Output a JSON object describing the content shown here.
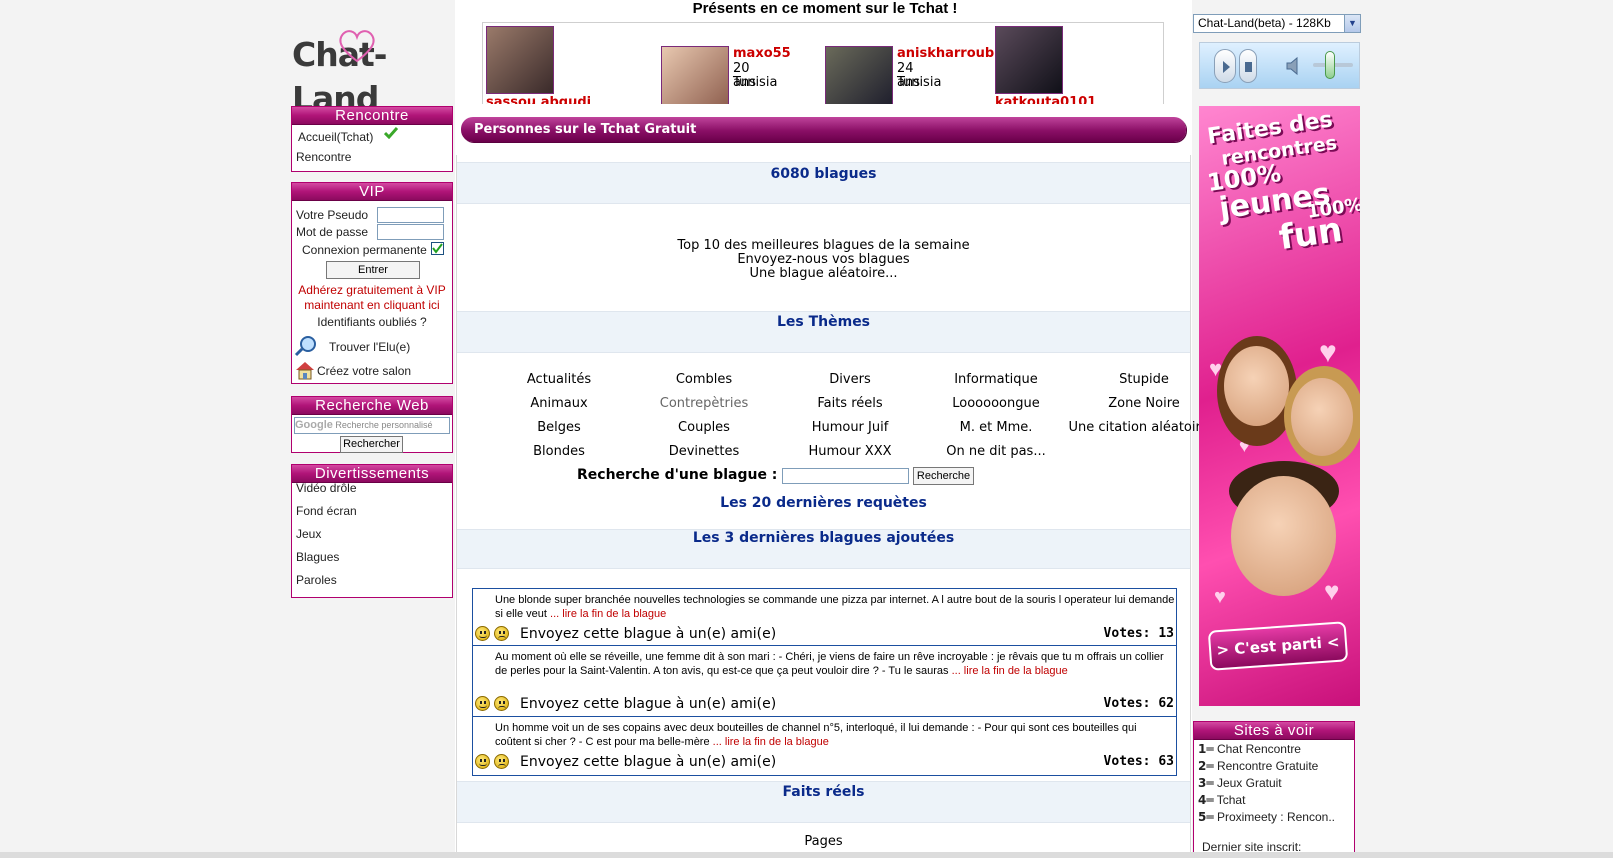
{
  "logo": {
    "text": "Chat-Land"
  },
  "header": {
    "present_title": "Présents en ce moment sur le Tchat !"
  },
  "online_users": [
    {
      "pseudo": "sassou  abqudi"
    },
    {
      "pseudo": "maxo55",
      "age": "20 ans",
      "country": "Tunisia"
    },
    {
      "pseudo": "aniskharroubi",
      "age": "24 ans",
      "country": "Tunisia"
    },
    {
      "pseudo": "katkouta0101"
    }
  ],
  "left": {
    "rencontre": {
      "title": "Rencontre",
      "items": [
        "Accueil(Tchat)",
        "Rencontre"
      ]
    },
    "vip": {
      "title": "VIP",
      "pseudo_label": "Votre Pseudo",
      "password_label": "Mot de passe",
      "permanent_label": "Connexion permanente",
      "enter_button": "Entrer",
      "join_line1": "Adhérez gratuitement à  VIP",
      "join_line2": "maintenant en cliquant ici",
      "forgot": "Identifiants oubliés ?",
      "find_love": "Trouver l'Elu(e)",
      "create_room": "Créez votre salon"
    },
    "web_search": {
      "title": "Recherche Web",
      "placeholder": "Recherche personnalisé",
      "button": "Rechercher",
      "google": "Google"
    },
    "entertainment": {
      "title": "Divertissements",
      "items": [
        "Vidéo drôle",
        "Fond écran",
        "Jeux",
        "Blagues",
        "Paroles"
      ]
    }
  },
  "center": {
    "bar_title": "Personnes sur le Tchat Gratuit",
    "count_title": "6080 blagues",
    "links": [
      "Top 10 des meilleures blagues de la semaine",
      "Envoyez-nous vos blagues",
      "Une blague aléatoire..."
    ],
    "themes_title": "Les Thèmes",
    "themes": [
      [
        "Actualités",
        "Combles",
        "Divers",
        "Informatique",
        "Stupide"
      ],
      [
        "Animaux",
        "Contrepètries",
        "Faits réels",
        "Loooooongue",
        "Zone Noire"
      ],
      [
        "Belges",
        "Couples",
        "Humour Juif",
        "M. et Mme.",
        "Une citation aléatoire?"
      ],
      [
        "Blondes",
        "Devinettes",
        "Humour XXX",
        "On ne dit pas...",
        ""
      ]
    ],
    "search_label": "Recherche d'une blague :",
    "search_button": "Recherche",
    "last_queries": "Les 20 dernières requètes",
    "last_jokes_title": "Les 3 dernières blagues ajoutées",
    "jokes": [
      {
        "text": "Une blonde super branchée nouvelles technologies se commande une pizza par internet. A l autre bout de la souris l operateur lui demande si elle veut",
        "more": "... lire la fin de la blague",
        "send": "Envoyez cette blague à un(e) ami(e)",
        "votes": "Votes: 13"
      },
      {
        "text": "Au moment où elle se réveille, une femme dit à son mari : - Chéri, je viens de faire un rêve incroyable : je rêvais que tu m offrais un collier de perles pour la Saint-Valentin. A ton avis, qu est-ce que ça peut vouloir dire ? - Tu le sauras",
        "more": "... lire la fin de la blague",
        "send": "Envoyez cette blague à un(e) ami(e)",
        "votes": "Votes: 62"
      },
      {
        "text": "Un homme voit un de ses copains avec deux bouteilles de channel n°5, interloqué, il lui demande : - Pour qui sont ces bouteilles qui coûtent si cher ? - C est pour ma belle-mère",
        "more": "... lire la fin de la blague",
        "send": "Envoyez cette blague à un(e) ami(e)",
        "votes": "Votes: 63"
      }
    ],
    "faits_title": "Faits réels",
    "pages_label": "Pages"
  },
  "right": {
    "player_select": "Chat-Land(beta) - 128Kb",
    "ad": {
      "line1": "Faites des",
      "line2": "rencontres",
      "line3": "100%",
      "line4": "jeunes",
      "line5": "100%",
      "line6": "fun",
      "cta": "> C'est parti <"
    },
    "sites": {
      "title": "Sites à voir",
      "items": [
        {
          "num": "1",
          "label": "Chat Rencontre"
        },
        {
          "num": "2",
          "label": "Rencontre Gratuite"
        },
        {
          "num": "3",
          "label": "Jeux Gratuit"
        },
        {
          "num": "4",
          "label": "Tchat"
        },
        {
          "num": "5",
          "label": "Proximeety : Rencon.."
        }
      ],
      "last_site": "Dernier site inscrit:"
    }
  },
  "colors": {
    "accent": "#b01478",
    "link_blue": "#0a2a8a",
    "red": "#c00000"
  }
}
